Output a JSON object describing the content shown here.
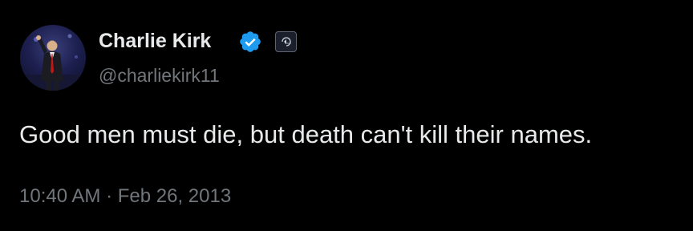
{
  "author": {
    "display_name": "Charlie Kirk",
    "handle": "@charliekirk11",
    "verified": true,
    "verified_color": "#1d9bf0"
  },
  "tweet": {
    "text": "Good men must die, but death can't kill their names.",
    "timestamp": "10:40 AM · Feb 26, 2013"
  },
  "icons": {
    "verified": "verified-check-icon",
    "affiliate": "affiliate-org-icon"
  },
  "colors": {
    "background": "#000000",
    "primary_text": "#e7e9ea",
    "secondary_text": "#71767b"
  }
}
